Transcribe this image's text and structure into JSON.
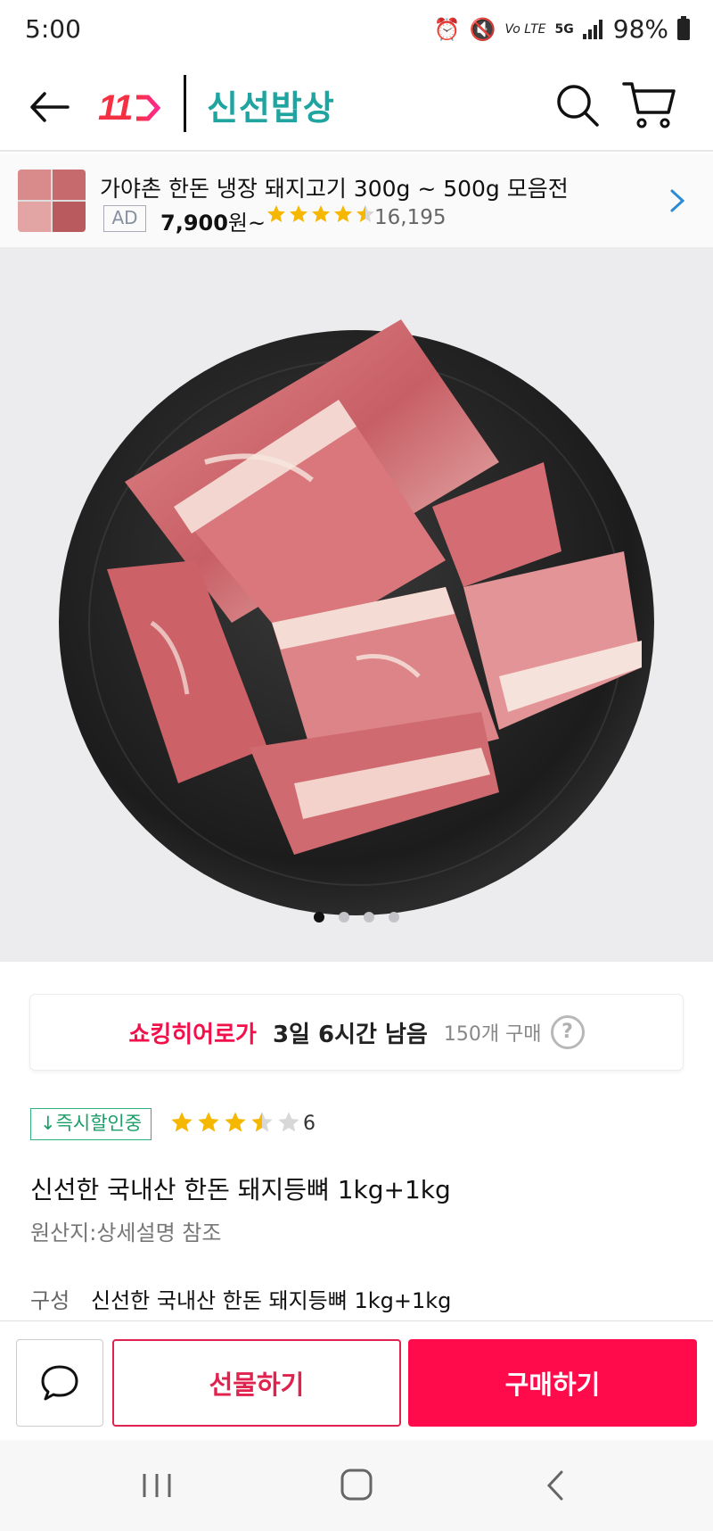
{
  "status_bar": {
    "time": "5:00",
    "network_label": "5G",
    "volte_label": "Vo LTE",
    "battery": "98%"
  },
  "header": {
    "logo_text": "11",
    "brand_name": "신선밥상",
    "icons": [
      "arrow-left-icon",
      "search-icon",
      "cart-icon"
    ]
  },
  "ad": {
    "title": "가야촌 한돈 냉장 돼지고기 300g ~ 500g 모음전",
    "badge": "AD",
    "price": "7,900",
    "price_suffix": "원~",
    "rating": 4.5,
    "review_count": "16,195",
    "star_color": "#f5b700"
  },
  "product_image": {
    "slide_count": 4,
    "active_slide": 1
  },
  "hero": {
    "label": "쇼킹히어로가",
    "remaining": "3일 6시간 남음",
    "purchase": "150개 구매",
    "help": "?"
  },
  "rating_row": {
    "badge": "↓즉시할인중",
    "rating": 3.5,
    "review_count": "6"
  },
  "product": {
    "title": "신선한 국내산 한돈 돼지등뼈 1kg+1kg",
    "origin": "원산지:상세설명 참조",
    "composition_label": "구성",
    "composition_value": "신선한 국내산 한돈 돼지등뼈 1kg+1kg"
  },
  "actions": {
    "gift": "선물하기",
    "buy": "구매하기",
    "accent": "#ff0a4a"
  },
  "colors": {
    "brand_red": "#f43142",
    "brand_teal": "#1fa4a0",
    "hero_pink": "#f2104b"
  }
}
